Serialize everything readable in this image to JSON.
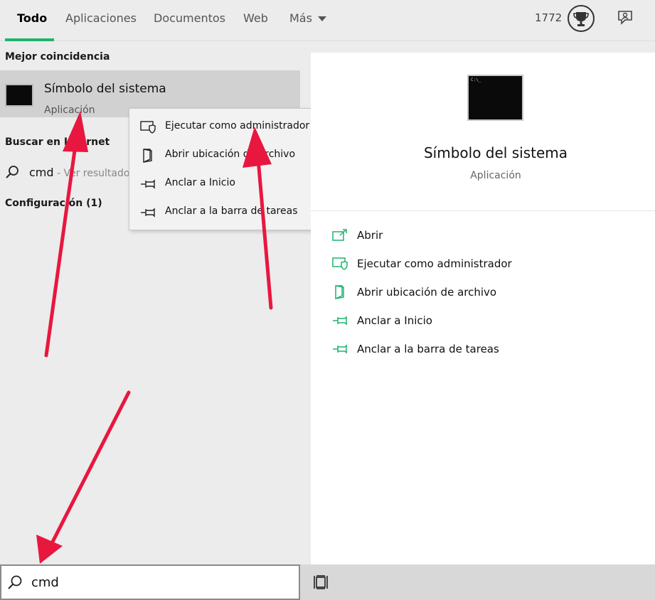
{
  "tabs": [
    {
      "label": "Todo",
      "active": true
    },
    {
      "label": "Aplicaciones"
    },
    {
      "label": "Documentos"
    },
    {
      "label": "Web"
    },
    {
      "label": "Más"
    }
  ],
  "header": {
    "points": "1772",
    "trophy_icon": "trophy-icon",
    "feedback_icon": "feedback-icon"
  },
  "left": {
    "best_match_heading": "Mejor coincidencia",
    "best_match": {
      "title": "Símbolo del sistema",
      "subtitle": "Aplicación"
    },
    "internet_heading": "Buscar en Internet",
    "internet_result": {
      "query": "cmd",
      "hint": " - Ver resultados"
    },
    "settings_heading": "Configuración (1)"
  },
  "context_menu": [
    {
      "label": "Ejecutar como administrador",
      "icon": "shield-icon"
    },
    {
      "label": "Abrir ubicación de archivo",
      "icon": "folder-icon"
    },
    {
      "label": "Anclar a Inicio",
      "icon": "pin-icon"
    },
    {
      "label": "Anclar a la barra de tareas",
      "icon": "pin-icon"
    }
  ],
  "right": {
    "title": "Símbolo del sistema",
    "subtitle": "Aplicación",
    "actions": [
      {
        "label": "Abrir",
        "icon": "open-icon"
      },
      {
        "label": "Ejecutar como administrador",
        "icon": "shield-icon"
      },
      {
        "label": "Abrir ubicación de archivo",
        "icon": "folder-icon"
      },
      {
        "label": "Anclar a Inicio",
        "icon": "pin-icon"
      },
      {
        "label": "Anclar a la barra de tareas",
        "icon": "pin-icon"
      }
    ]
  },
  "search": {
    "value": "cmd"
  },
  "colors": {
    "accent": "#1fb36f",
    "arrow": "#e8173f"
  }
}
